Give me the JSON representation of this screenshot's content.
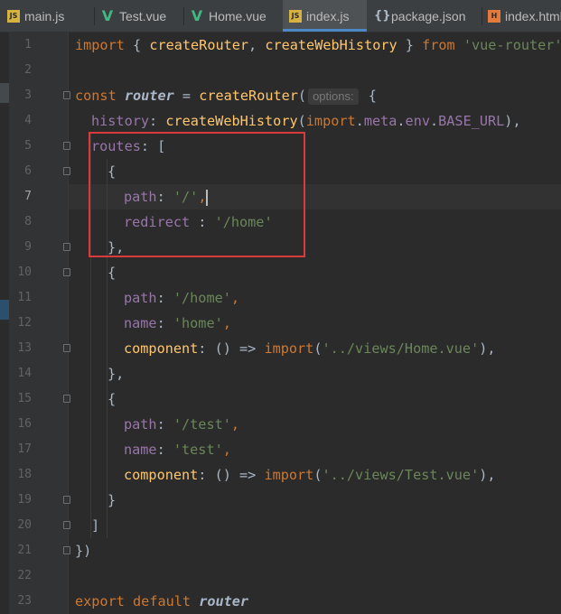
{
  "tabs": [
    {
      "label": "main.js",
      "icon": "js-file-icon",
      "badge": "JS",
      "active": false
    },
    {
      "label": "Test.vue",
      "icon": "vue-file-icon",
      "badge": "V",
      "active": false
    },
    {
      "label": "Home.vue",
      "icon": "vue-file-icon",
      "badge": "V",
      "active": false
    },
    {
      "label": "index.js",
      "icon": "js-file-icon",
      "badge": "JS",
      "active": true
    },
    {
      "label": "package.json",
      "icon": "json-file-icon",
      "badge": "{}",
      "active": false
    },
    {
      "label": "index.html",
      "icon": "html-file-icon",
      "badge": "H",
      "active": false
    }
  ],
  "editor": {
    "current_line": 7,
    "inlay_hint": "options:",
    "lines": [
      {
        "n": "1"
      },
      {
        "n": "2"
      },
      {
        "n": "3"
      },
      {
        "n": "4"
      },
      {
        "n": "5"
      },
      {
        "n": "6"
      },
      {
        "n": "7"
      },
      {
        "n": "8"
      },
      {
        "n": "9"
      },
      {
        "n": "10"
      },
      {
        "n": "11"
      },
      {
        "n": "12"
      },
      {
        "n": "13"
      },
      {
        "n": "14"
      },
      {
        "n": "15"
      },
      {
        "n": "16"
      },
      {
        "n": "17"
      },
      {
        "n": "18"
      },
      {
        "n": "19"
      },
      {
        "n": "20"
      },
      {
        "n": "21"
      },
      {
        "n": "22"
      },
      {
        "n": "23"
      }
    ]
  },
  "code_tokens": {
    "l1": [
      "import",
      " { ",
      "createRouter",
      ", ",
      "createWebHistory",
      " } ",
      "from",
      " ",
      "'vue-router'"
    ],
    "l3": [
      "const",
      " ",
      "router",
      " = ",
      "createRouter",
      "(",
      " {"
    ],
    "l4": [
      "history",
      ": ",
      "createWebHistory",
      "(",
      "import",
      ".",
      "meta",
      ".",
      "env",
      ".",
      "BASE_URL",
      "),"
    ],
    "l5": [
      "routes",
      ": ["
    ],
    "l6": [
      "{"
    ],
    "l7": [
      "path",
      ": ",
      "'/'",
      ","
    ],
    "l8": [
      "redirect",
      " : ",
      "'/home'"
    ],
    "l9": [
      "},"
    ],
    "l10": [
      "{"
    ],
    "l11": [
      "path",
      ": ",
      "'/home'",
      ","
    ],
    "l12": [
      "name",
      ": ",
      "'home'",
      ","
    ],
    "l13": [
      "component",
      ": () => ",
      "import",
      "(",
      "'../views/Home.vue'",
      "),"
    ],
    "l14": [
      "},"
    ],
    "l15": [
      "{"
    ],
    "l16": [
      "path",
      ": ",
      "'/test'",
      ","
    ],
    "l17": [
      "name",
      ": ",
      "'test'",
      ","
    ],
    "l18": [
      "component",
      ": () => ",
      "import",
      "(",
      "'../views/Test.vue'",
      "),"
    ],
    "l19": [
      "}"
    ],
    "l20": [
      "]"
    ],
    "l21": [
      "})"
    ],
    "l23": [
      "export",
      " ",
      "default",
      " ",
      "router"
    ]
  },
  "colors": {
    "keyword": "#cc7832",
    "function": "#ffc66d",
    "string": "#6a8759",
    "property": "#9876aa",
    "default_text": "#a9b7c6",
    "highlight_box": "#d93a3a",
    "active_tab_underline": "#4a88c7"
  }
}
